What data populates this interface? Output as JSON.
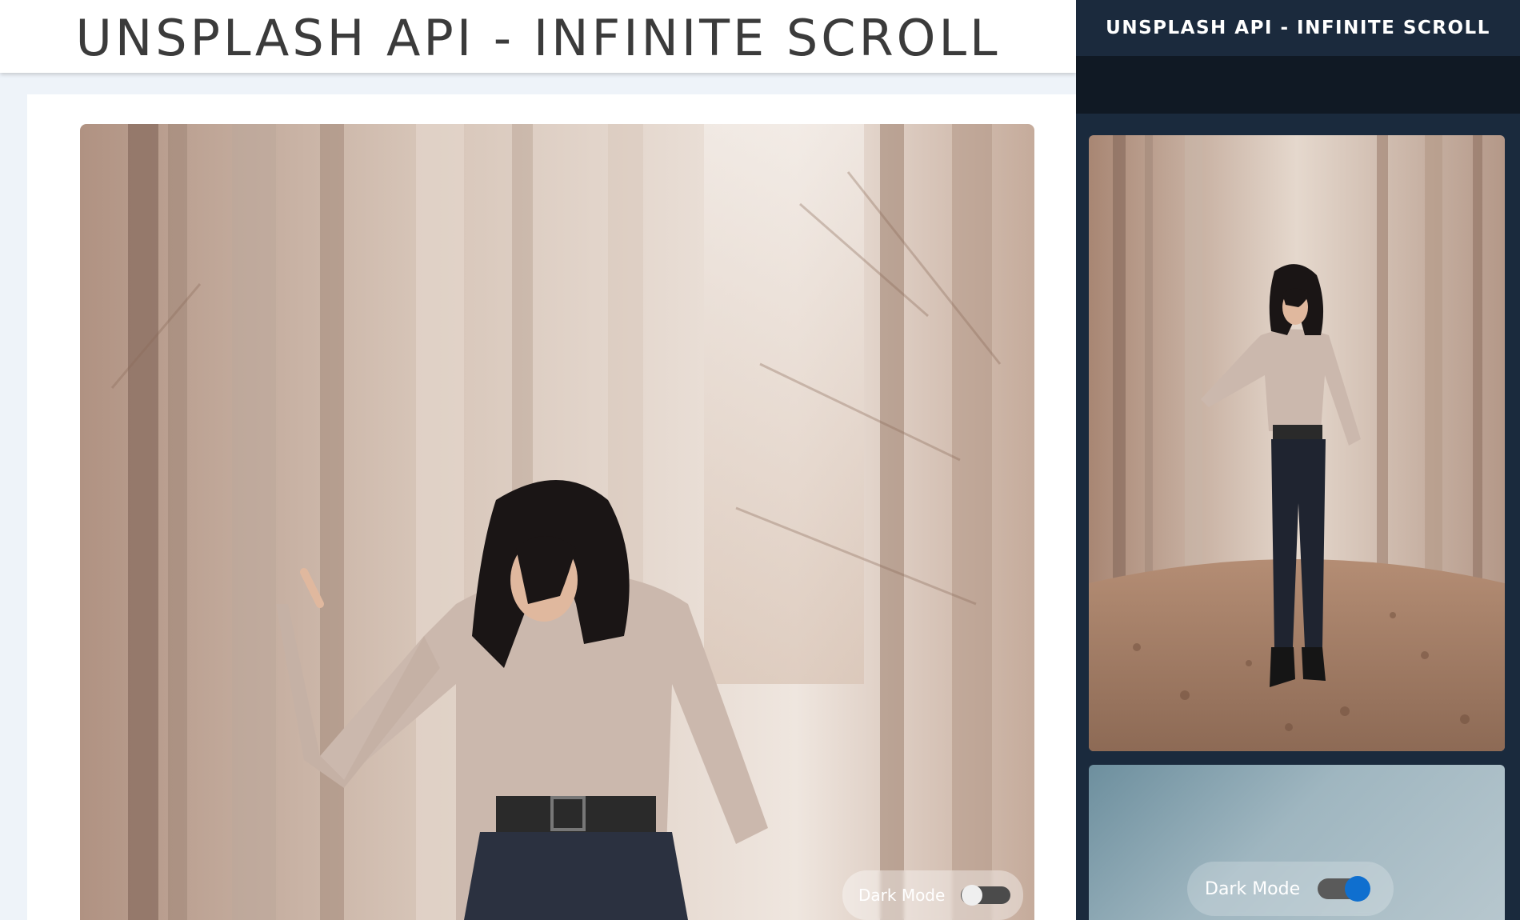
{
  "light_view": {
    "title": "UNSPLASH API - INFINITE SCROLL",
    "dark_mode_toggle": {
      "label": "Dark Mode",
      "enabled": false
    }
  },
  "dark_view": {
    "title": "UNSPLASH API - INFINITE SCROLL",
    "dark_mode_toggle": {
      "label": "Dark Mode",
      "enabled": true
    }
  },
  "colors": {
    "light_background": "#eef3f9",
    "dark_background": "#1a2a3d",
    "toggle_on": "#0f6fcf"
  }
}
